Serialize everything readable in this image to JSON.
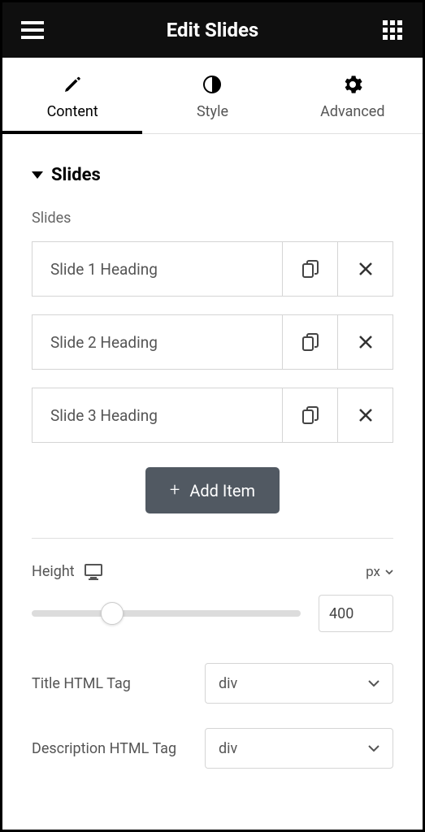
{
  "header": {
    "title": "Edit Slides"
  },
  "tabs": [
    {
      "label": "Content",
      "active": true
    },
    {
      "label": "Style",
      "active": false
    },
    {
      "label": "Advanced",
      "active": false
    }
  ],
  "section": {
    "title": "Slides"
  },
  "slides": {
    "label": "Slides",
    "items": [
      "Slide 1 Heading",
      "Slide 2 Heading",
      "Slide 3 Heading"
    ]
  },
  "add_button": "Add Item",
  "height": {
    "label": "Height",
    "unit": "px",
    "value": "400",
    "slider_percent": 30
  },
  "title_tag": {
    "label": "Title HTML Tag",
    "value": "div"
  },
  "description_tag": {
    "label": "Description HTML Tag",
    "value": "div"
  }
}
